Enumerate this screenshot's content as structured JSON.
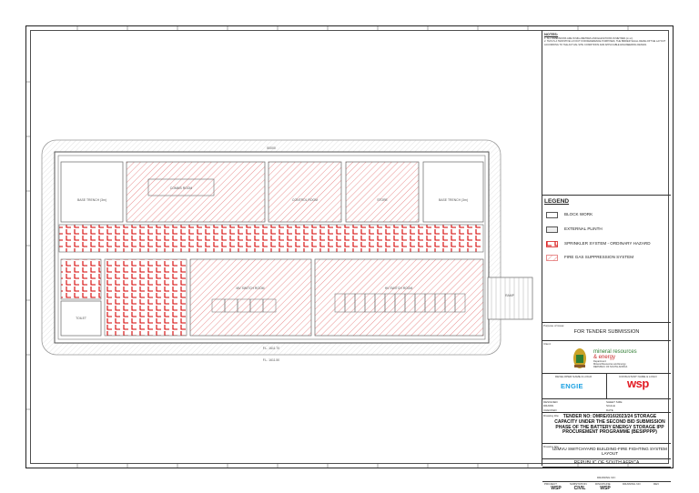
{
  "notes": {
    "title": "NOTES:",
    "lines": [
      "1.  ALL DIMENSIONS ARE IN MILLIMETRES AND ELEVATIONS IN METRES (m.s.l).",
      "2.  THIS IS A TENTATIVE LAYOUT FOR REFERENCE PURPOSES, THE BIDDER SHALL DEVELOP THE LAYOUT ACCORDING TO THE ACTUAL SITE CONDITIONS AND APPLICABLE ENGINEERING DESIGN."
    ]
  },
  "legend": {
    "title": "LEGEND",
    "items": [
      {
        "label": "BLOCK WORK",
        "swatch": "block"
      },
      {
        "label": "EXTERNAL PLINTH",
        "swatch": "plinth"
      },
      {
        "label": "SPRINKLER SYSTEM - ORDINARY HAZARD",
        "swatch": "sprinkler"
      },
      {
        "label": "FIRE GAS SUPPRESSION SYSTEM",
        "swatch": "gas"
      }
    ]
  },
  "purpose": {
    "label": "Purpose of issue:",
    "value": "FOR TENDER SUBMISSION"
  },
  "client": {
    "label": "Client:",
    "name_line1": "mineral resources",
    "name_line2": "& energy",
    "sub1": "Department:",
    "sub2": "Mineral Resources and Energy",
    "sub3": "REPUBLIC OF SOUTH AFRICA"
  },
  "developer": {
    "label": "DEVELOPER NAME & LOGO",
    "logo_text": "ENGIE"
  },
  "consultant": {
    "label": "CONSULTANT NAME & LOGO",
    "logo_text": "wsp"
  },
  "rev_table": {
    "rows": [
      {
        "k1": "DESIGNED",
        "k2": "SHEET SIZE"
      },
      {
        "k1": "DRAWN",
        "k2": "SCALE"
      },
      {
        "k1": "CHECKED",
        "k2": "DATE"
      }
    ]
  },
  "drawing_title": {
    "label": "Drawing title:",
    "text": "TENDER NO: DMRE/016/2023/24 STORAGE CAPACITY UNDER THE SECOND BID SUBMISSION PHASE OF THE BATTERY ENERGY STORAGE IPP PROCUREMENT PROGRAMME (BESIPPPP)"
  },
  "drawing_subtitle": {
    "label": "Drawing title:",
    "text": "IZIMVU SWITCHYARD BUILDING-FIRE FIGHTING SYSTEM LAYOUT"
  },
  "country": "REPUBLIC OF SOUTH AFRICA",
  "bottom": {
    "headers": [
      "PROJECT",
      "SUBSTATION",
      "DISCIPLINE",
      "DRAWING NO",
      "REV"
    ],
    "values": [
      "WSP",
      "CIVIL",
      "WSP",
      "",
      ""
    ],
    "mid_label": "DRAWING NO:"
  },
  "plan": {
    "rooms": {
      "left_top": "BASE TRENCH (3m)",
      "right_top": "BASE TRENCH (3m)",
      "comms": "COMMS ROOM",
      "ctrl": "CONTROL ROOM",
      "store": "STORE",
      "mv": "MV SWITCH ROOM",
      "hv": "HV SWITCH ROOM",
      "wc": "TOILET",
      "corridor": "CORRIDOR",
      "ramp": "RAMP"
    },
    "dims": {
      "top": "50000",
      "bottom1": "F.L. 1611.70",
      "bottom2": "F.L. 1611.50"
    }
  }
}
